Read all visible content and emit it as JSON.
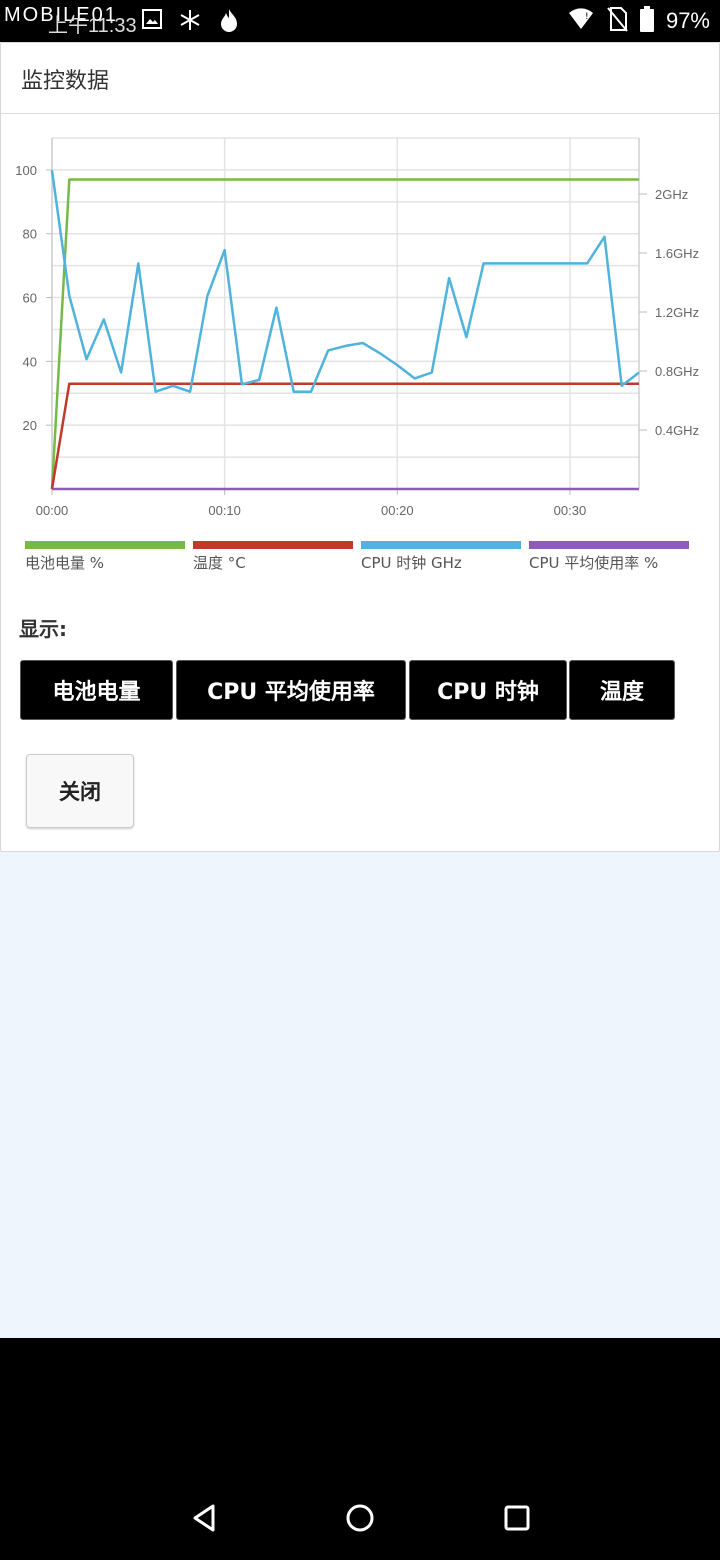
{
  "status_bar": {
    "logo": "MOBILE01",
    "time": "上午11:33",
    "battery": "97%",
    "icons": [
      "image-icon",
      "snowflake-icon",
      "flame-icon",
      "wifi-icon",
      "no-sim-icon",
      "battery-icon"
    ]
  },
  "card": {
    "title": "监控数据"
  },
  "chart_data": {
    "type": "line",
    "x_ticks": [
      "00:00",
      "00:10",
      "00:20",
      "00:30"
    ],
    "x_range_seconds": [
      0,
      34
    ],
    "y_left_ticks": [
      "20",
      "40",
      "60",
      "80",
      "100"
    ],
    "y_left_range": [
      0,
      110
    ],
    "y_right_ticks": [
      "0.4GHz",
      "0.8GHz",
      "1.2GHz",
      "1.6GHz",
      "2GHz"
    ],
    "y_right_range_ghz": [
      0,
      2.38
    ],
    "grid": true,
    "legend_position": "bottom",
    "series": [
      {
        "name": "电池电量 %",
        "axis": "left",
        "color": "#76b947",
        "points": [
          [
            0,
            0
          ],
          [
            1,
            97
          ],
          [
            34,
            97
          ]
        ]
      },
      {
        "name": "温度 °C",
        "axis": "left",
        "color": "#c0392b",
        "points": [
          [
            0,
            0
          ],
          [
            1,
            33
          ],
          [
            34,
            33
          ]
        ]
      },
      {
        "name": "CPU 时钟 GHz",
        "axis": "right",
        "color": "#4fb3dc",
        "points": [
          [
            0,
            2.16
          ],
          [
            1,
            1.31
          ],
          [
            2,
            0.88
          ],
          [
            3,
            1.15
          ],
          [
            4,
            0.79
          ],
          [
            5,
            1.53
          ],
          [
            6,
            0.66
          ],
          [
            7,
            0.7
          ],
          [
            8,
            0.66
          ],
          [
            9,
            1.31
          ],
          [
            10,
            1.62
          ],
          [
            11,
            0.71
          ],
          [
            12,
            0.74
          ],
          [
            13,
            1.23
          ],
          [
            14,
            0.66
          ],
          [
            15,
            0.66
          ],
          [
            16,
            0.94
          ],
          [
            17,
            0.97
          ],
          [
            18,
            0.99
          ],
          [
            19,
            0.92
          ],
          [
            20,
            0.84
          ],
          [
            21,
            0.75
          ],
          [
            22,
            0.79
          ],
          [
            23,
            1.43
          ],
          [
            24,
            1.03
          ],
          [
            25,
            1.53
          ],
          [
            26,
            1.53
          ],
          [
            27,
            1.53
          ],
          [
            28,
            1.53
          ],
          [
            29,
            1.53
          ],
          [
            30,
            1.53
          ],
          [
            31,
            1.53
          ],
          [
            32,
            1.71
          ],
          [
            33,
            0.7
          ],
          [
            34,
            0.79
          ]
        ]
      },
      {
        "name": "CPU 平均使用率 %",
        "axis": "left",
        "color": "#8e5bb5",
        "points": [
          [
            0,
            0
          ],
          [
            34,
            0
          ]
        ]
      }
    ]
  },
  "show": {
    "label": "显示:",
    "buttons": [
      "电池电量",
      "CPU 平均使用率",
      "CPU 时钟",
      "温度"
    ]
  },
  "close_label": "关闭",
  "nav": [
    "back-icon",
    "home-icon",
    "recents-icon"
  ]
}
